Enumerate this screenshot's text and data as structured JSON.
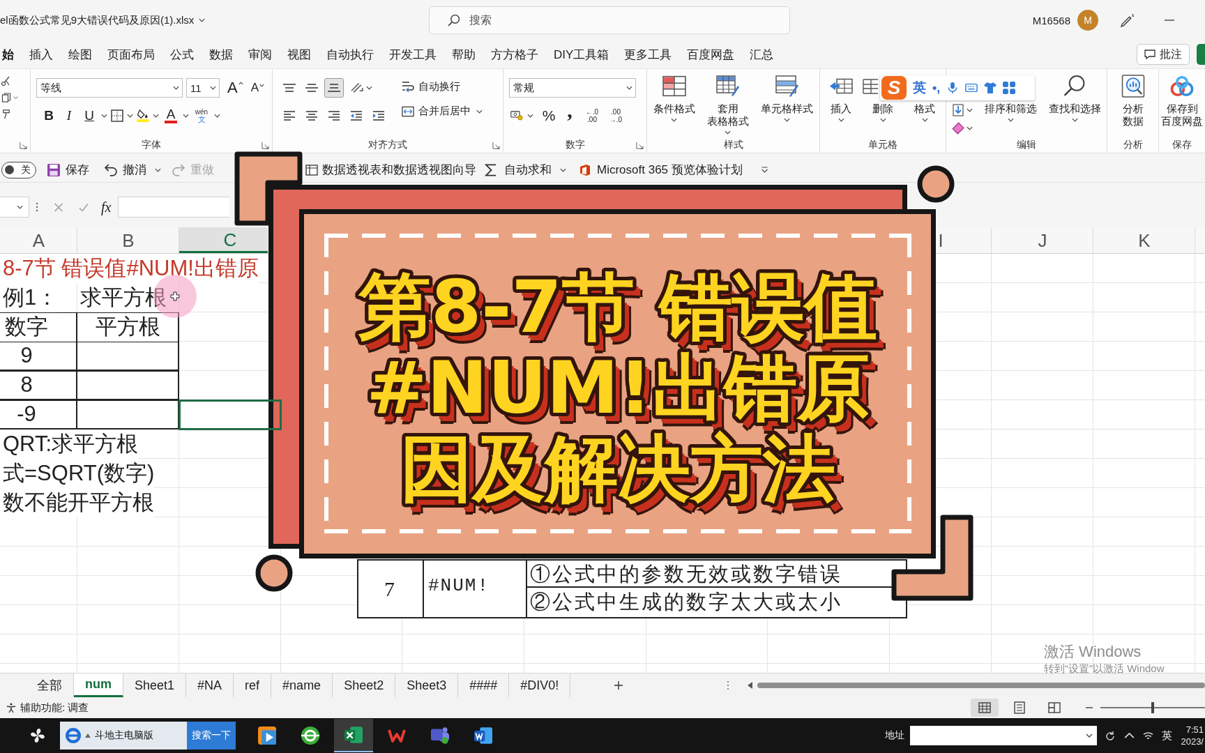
{
  "title_bar": {
    "file_name": "el函数公式常见9大错误代码及原因(1).xlsx",
    "search_placeholder": "搜索",
    "account": "M16568",
    "avatar_initial": "M"
  },
  "menu_tabs": [
    {
      "label": "始",
      "selected": true
    },
    {
      "label": "插入",
      "selected": false
    },
    {
      "label": "绘图",
      "selected": false
    },
    {
      "label": "页面布局",
      "selected": false
    },
    {
      "label": "公式",
      "selected": false
    },
    {
      "label": "数据",
      "selected": false
    },
    {
      "label": "审阅",
      "selected": false
    },
    {
      "label": "视图",
      "selected": false
    },
    {
      "label": "自动执行",
      "selected": false
    },
    {
      "label": "开发工具",
      "selected": false
    },
    {
      "label": "帮助",
      "selected": false
    },
    {
      "label": "方方格子",
      "selected": false
    },
    {
      "label": "DIY工具箱",
      "selected": false
    },
    {
      "label": "更多工具",
      "selected": false
    },
    {
      "label": "百度网盘",
      "selected": false
    },
    {
      "label": "汇总",
      "selected": false
    }
  ],
  "comments_button": "批注",
  "ribbon": {
    "font": {
      "font_name": "等线",
      "font_size": "11",
      "grow_font": "A",
      "shrink_font": "A",
      "bold": "B",
      "italic": "I",
      "underline": "U",
      "font_color": "A",
      "phonetic_top": "wén",
      "phonetic_bottom": "文",
      "label": "字体"
    },
    "alignment": {
      "vertical_align": [
        {
          "selected": false
        },
        {
          "selected": false
        },
        {
          "selected": true
        }
      ],
      "wrap_text": "自动换行",
      "merge_center": "合并后居中",
      "label": "对齐方式"
    },
    "number": {
      "format": "常规",
      "percent": "%",
      "comma": ",",
      "increase_decimal": [
        "←.0",
        ".00"
      ],
      "decrease_decimal": [
        ".00",
        "→.0"
      ],
      "label": "数字"
    },
    "styles": {
      "buttons": [
        {
          "lines": [
            "条件格式"
          ]
        },
        {
          "lines": [
            "套用",
            "表格格式"
          ]
        },
        {
          "lines": [
            "单元格样式"
          ]
        }
      ],
      "label": "样式"
    },
    "cells": {
      "buttons": [
        {
          "lines": [
            "插入"
          ]
        },
        {
          "lines": [
            "删除"
          ]
        },
        {
          "lines": [
            "格式"
          ]
        }
      ],
      "label": "单元格"
    },
    "editing": {
      "buttons": [
        {
          "lines": [
            "排序和筛选"
          ]
        },
        {
          "lines": [
            "查找和选择"
          ]
        }
      ],
      "label": "编辑"
    },
    "analysis": {
      "buttons": [
        {
          "lines": [
            "分析",
            "数据"
          ]
        }
      ],
      "label": "分析"
    },
    "save": {
      "buttons": [
        {
          "lines": [
            "保存到",
            "百度网盘"
          ]
        }
      ],
      "label": "保存"
    }
  },
  "ime_toolbar": {
    "logo": "S",
    "mode": "英",
    "punctuation": "•,"
  },
  "qat": {
    "autosave": {
      "label": "关",
      "on": false
    },
    "save": "保存",
    "undo": "撤消",
    "redo": {
      "label": "重做",
      "disabled": true
    },
    "pivot_wizard": "数据透视表和数据透视图向导",
    "autosum": "自动求和",
    "insider": "Microsoft 365 预览体验计划"
  },
  "formula_bar": {
    "function_label": "fx"
  },
  "sheet": {
    "columns": [
      {
        "label": "A",
        "selected": false
      },
      {
        "label": "B",
        "selected": false
      },
      {
        "label": "C",
        "selected": true
      },
      {
        "label": "I",
        "selected": false
      },
      {
        "label": "J",
        "selected": false
      },
      {
        "label": "K",
        "selected": false
      }
    ],
    "rows": [
      {
        "kind": "title",
        "a": "8-7节 错误值#NUM!出错原",
        "selected": false
      },
      {
        "kind": "text",
        "a": "例1：",
        "b": "求平方根",
        "selected": false
      },
      {
        "kind": "table",
        "a": "数字",
        "b": "平方根",
        "selected": false
      },
      {
        "kind": "table",
        "a": "9",
        "selected": false
      },
      {
        "kind": "table",
        "a": "8",
        "selected": false
      },
      {
        "kind": "table",
        "a": "-9",
        "selected": true
      },
      {
        "kind": "text",
        "a": "QRT:求平方根",
        "selected": false
      },
      {
        "kind": "text",
        "a": "式=SQRT(数字)",
        "selected": false
      },
      {
        "kind": "text",
        "a": "数不能开平方根",
        "selected": false
      }
    ]
  },
  "error_table": {
    "rows": [
      {
        "number": "7",
        "error": "#NUM!",
        "reasons": [
          "①公式中的参数无效或数字错误",
          "②公式中生成的数字太大或太小"
        ]
      }
    ]
  },
  "cover": {
    "title_lines": [
      "第8-7节 错误值",
      "#NUM!出错原",
      "因及解决方法"
    ]
  },
  "activation_notice": {
    "title": "激活 Windows",
    "subtitle": "转到“设置”以激活 Window"
  },
  "sheet_tabs": [
    {
      "label": "全部",
      "selected": false
    },
    {
      "label": "num",
      "selected": true
    },
    {
      "label": "Sheet1",
      "selected": false
    },
    {
      "label": "#NA",
      "selected": false
    },
    {
      "label": "ref",
      "selected": false
    },
    {
      "label": "#name",
      "selected": false
    },
    {
      "label": "Sheet2",
      "selected": false
    },
    {
      "label": "Sheet3",
      "selected": false
    },
    {
      "label": "####",
      "selected": false
    },
    {
      "label": "#DIV0!",
      "selected": false
    }
  ],
  "status_bar": {
    "accessibility": "辅助功能: 调查",
    "views": [
      {
        "selected": true
      },
      {
        "selected": false
      },
      {
        "selected": false
      }
    ],
    "zoom_slider": {
      "level": 0.5
    }
  },
  "taskbar": {
    "search_value": "斗地主电脑版",
    "search_button": "搜索一下",
    "apps": [
      {
        "selected": false
      },
      {
        "selected": false
      },
      {
        "selected": true
      },
      {
        "selected": false
      },
      {
        "selected": false
      },
      {
        "selected": false
      }
    ],
    "address_label": "地址",
    "input_mode": "英",
    "time": "7:51",
    "date": "2023/"
  }
}
